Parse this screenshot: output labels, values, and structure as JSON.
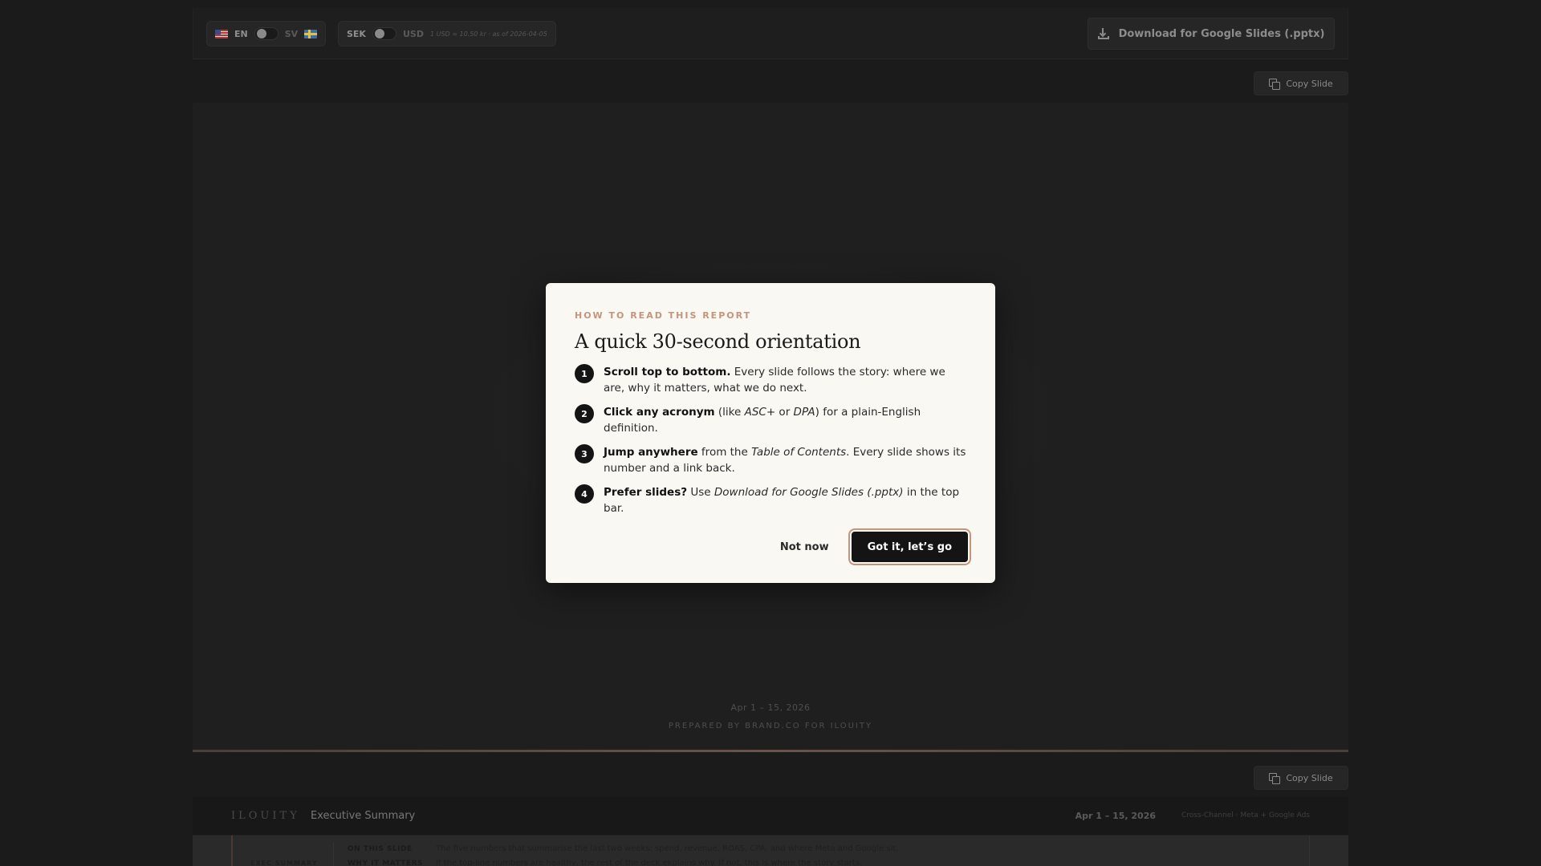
{
  "topbar": {
    "lang_en": "EN",
    "lang_sv": "SV",
    "cur_sek": "SEK",
    "cur_usd": "USD",
    "rate_note": "1 USD = 10.50 kr · as of 2026-04-05",
    "download_label": "Download for Google Slides (.pptx)"
  },
  "copy_slide_label": "Copy Slide",
  "slide1": {
    "date": "Apr 1 – 15, 2026",
    "prepared_by": "PREPARED BY BRAND.CO FOR ILOUITY"
  },
  "slide2": {
    "logo": "ILOUITY",
    "title": "Executive Summary",
    "date": "Apr 1 – 15, 2026",
    "channel": "Cross-Channel · Meta + Google Ads",
    "on_this_slide_label": "ON THIS SLIDE",
    "on_this_slide_text": "The five numbers that summarise the last two weeks: spend, revenue, ROAS, CPA, and where Meta and Google sit.",
    "why_label": "WHY IT MATTERS",
    "why_text": "If the top-line numbers are healthy, the rest of the deck explains why. If not, this is where the story starts.",
    "side_label": "EXEC SUMMARY"
  },
  "modal": {
    "eyebrow": "HOW TO READ THIS REPORT",
    "title": "A quick 30-second orientation",
    "steps": [
      {
        "num": "1",
        "bold": "Scroll top to bottom.",
        "rest": " Every slide follows the story: where we are, why it matters, what we do next."
      },
      {
        "num": "2",
        "bold": "Click any acronym",
        "pre": " (like ",
        "em1": "ASC+",
        "mid": " or ",
        "em2": "DPA",
        "post": ") for a plain-English definition."
      },
      {
        "num": "3",
        "bold": "Jump anywhere",
        "pre": " from the ",
        "em1": "Table of Contents",
        "post": ". Every slide shows its number and a link back."
      },
      {
        "num": "4",
        "bold": "Prefer slides?",
        "pre": " Use ",
        "em1": "Download for Google Slides (.pptx)",
        "post": " in the top bar."
      }
    ],
    "not_now": "Not now",
    "confirm": "Got it, let’s go"
  },
  "colors": {
    "accent": "#c4957a",
    "modal_bg": "#faf8f3",
    "page_bg": "#1b1b1b"
  },
  "icons": [
    "flag-us-icon",
    "flag-se-icon",
    "download-icon",
    "copy-icon"
  ]
}
